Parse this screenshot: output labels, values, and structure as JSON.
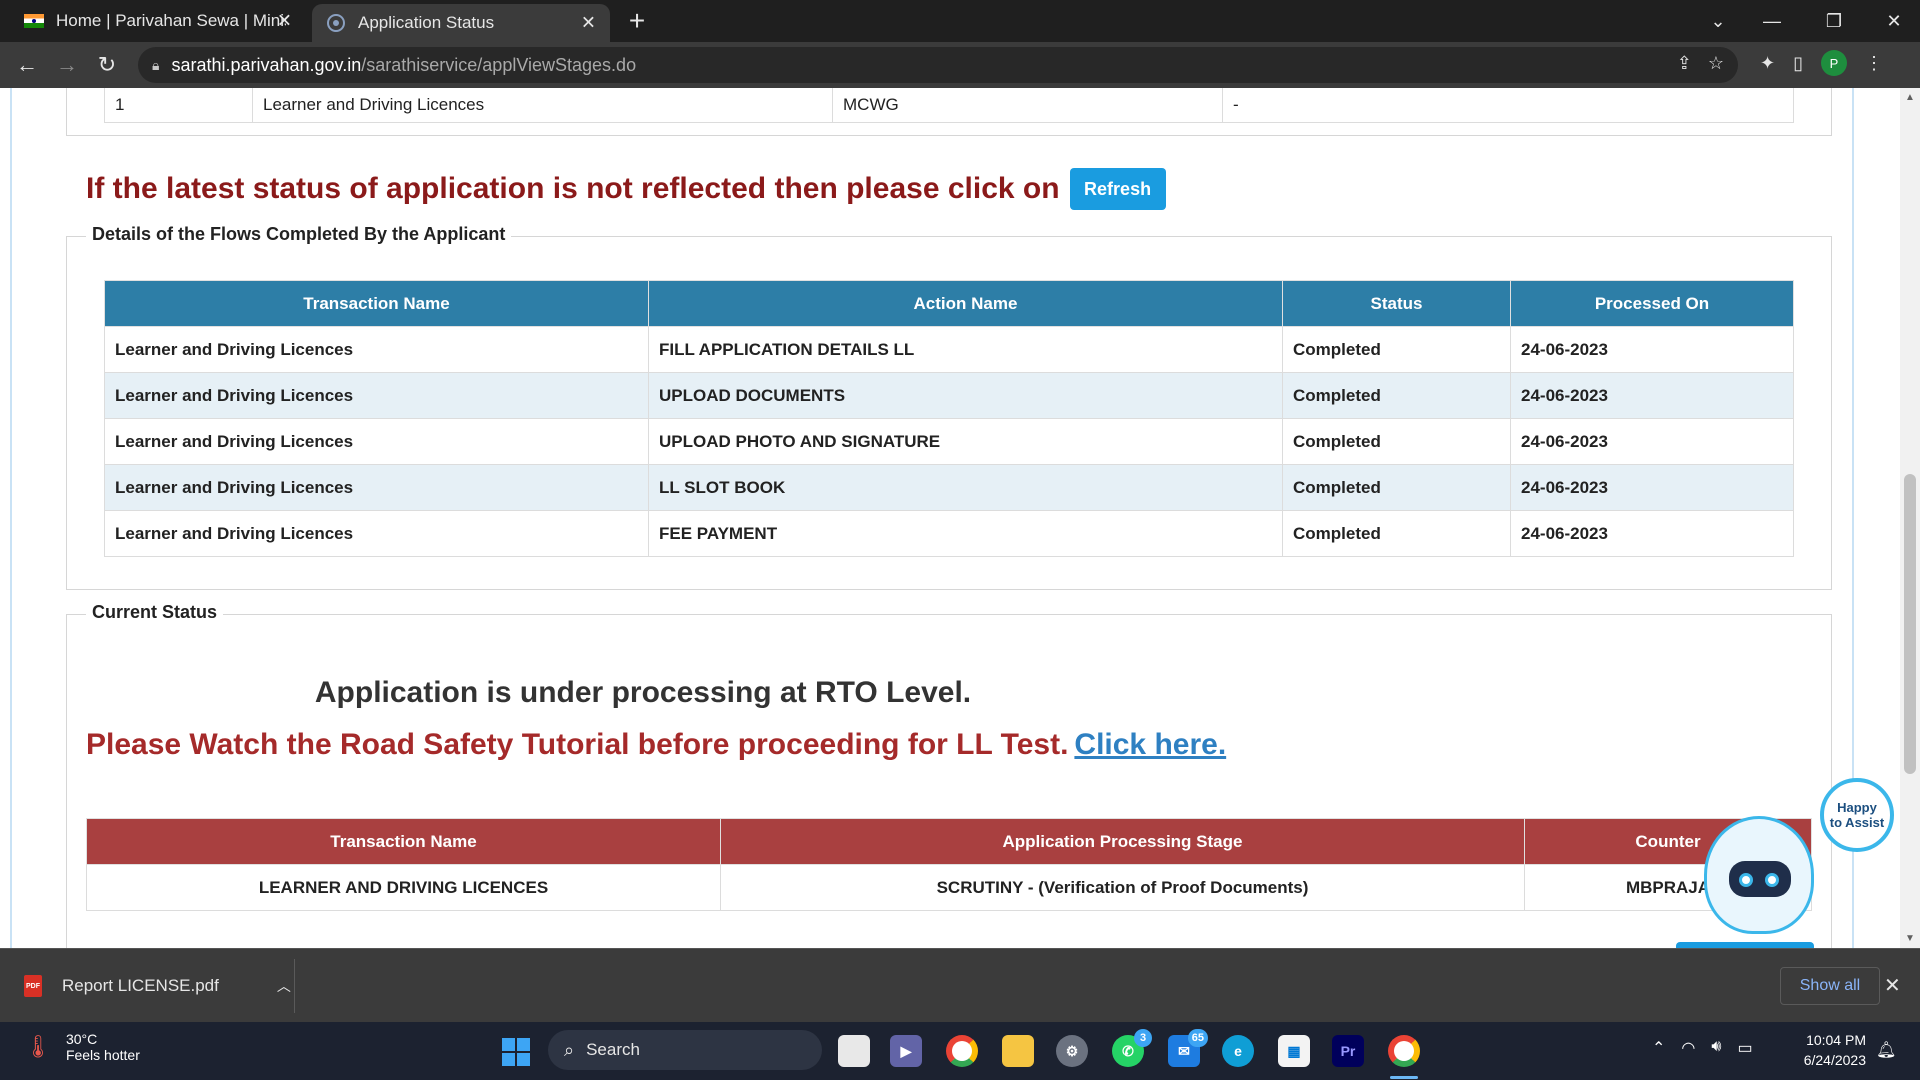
{
  "browser": {
    "tabs": [
      {
        "title": "Home | Parivahan Sewa | Ministry of Road Transport"
      },
      {
        "title": "Application Status"
      }
    ],
    "url_host": "sarathi.parivahan.gov.in",
    "url_path": "/sarathiservice/applViewStages.do",
    "profile_initial": "P"
  },
  "top_row": {
    "sno": "1",
    "transaction": "Learner and Driving Licences",
    "class": "MCWG",
    "extra": "-"
  },
  "refresh": {
    "message": "If the latest status of application is not reflected then please click on",
    "button_label": "Refresh"
  },
  "flows": {
    "legend": "Details of the Flows Completed By the Applicant",
    "headers": [
      "Transaction Name",
      "Action Name",
      "Status",
      "Processed On"
    ],
    "rows": [
      [
        "Learner and Driving Licences",
        "FILL APPLICATION DETAILS LL",
        "Completed",
        "24-06-2023"
      ],
      [
        "Learner and Driving Licences",
        "UPLOAD DOCUMENTS",
        "Completed",
        "24-06-2023"
      ],
      [
        "Learner and Driving Licences",
        "UPLOAD PHOTO AND SIGNATURE",
        "Completed",
        "24-06-2023"
      ],
      [
        "Learner and Driving Licences",
        "LL SLOT BOOK",
        "Completed",
        "24-06-2023"
      ],
      [
        "Learner and Driving Licences",
        "FEE PAYMENT",
        "Completed",
        "24-06-2023"
      ]
    ]
  },
  "current_status": {
    "legend": "Current Status",
    "processing_text": "Application is under processing at RTO Level.",
    "tutorial_text": "Please Watch the Road Safety Tutorial before proceeding for LL Test.",
    "tutorial_link": "Click here.",
    "headers": [
      "Transaction Name",
      "Application Processing Stage",
      "Counter"
    ],
    "row": [
      "LEARNER AND DRIVING LICENCES",
      "SCRUTINY - (Verification of Proof Documents)",
      "MBPRAJA"
    ]
  },
  "assistant": {
    "line1": "Happy",
    "line2": "to Assist"
  },
  "downloads": {
    "file_name": "Report LICENSE.pdf",
    "show_all": "Show all"
  },
  "taskbar": {
    "temperature": "30°C",
    "weather_desc": "Feels hotter",
    "search_label": "Search",
    "whatsapp_badge": "3",
    "mail_badge": "65",
    "time": "10:04 PM",
    "date": "6/24/2023"
  }
}
